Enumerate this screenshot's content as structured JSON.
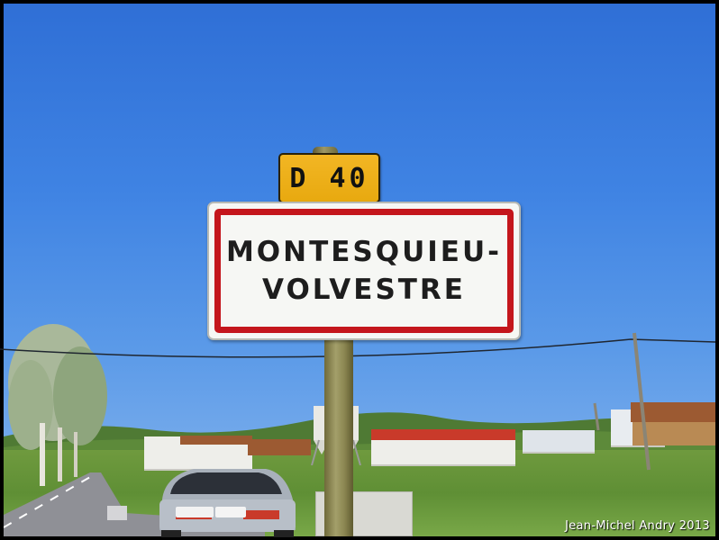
{
  "photo": {
    "road_sign": {
      "route_number": "D 40"
    },
    "town_sign": {
      "line_1": "MONTESQUIEU-",
      "line_2": "VOLVESTRE"
    },
    "credit": "Jean-Michel Andry 2013"
  },
  "colors": {
    "sign_red": "#c4161c",
    "sign_yellow": "#e8a90f",
    "sky": "#3f83e3"
  }
}
